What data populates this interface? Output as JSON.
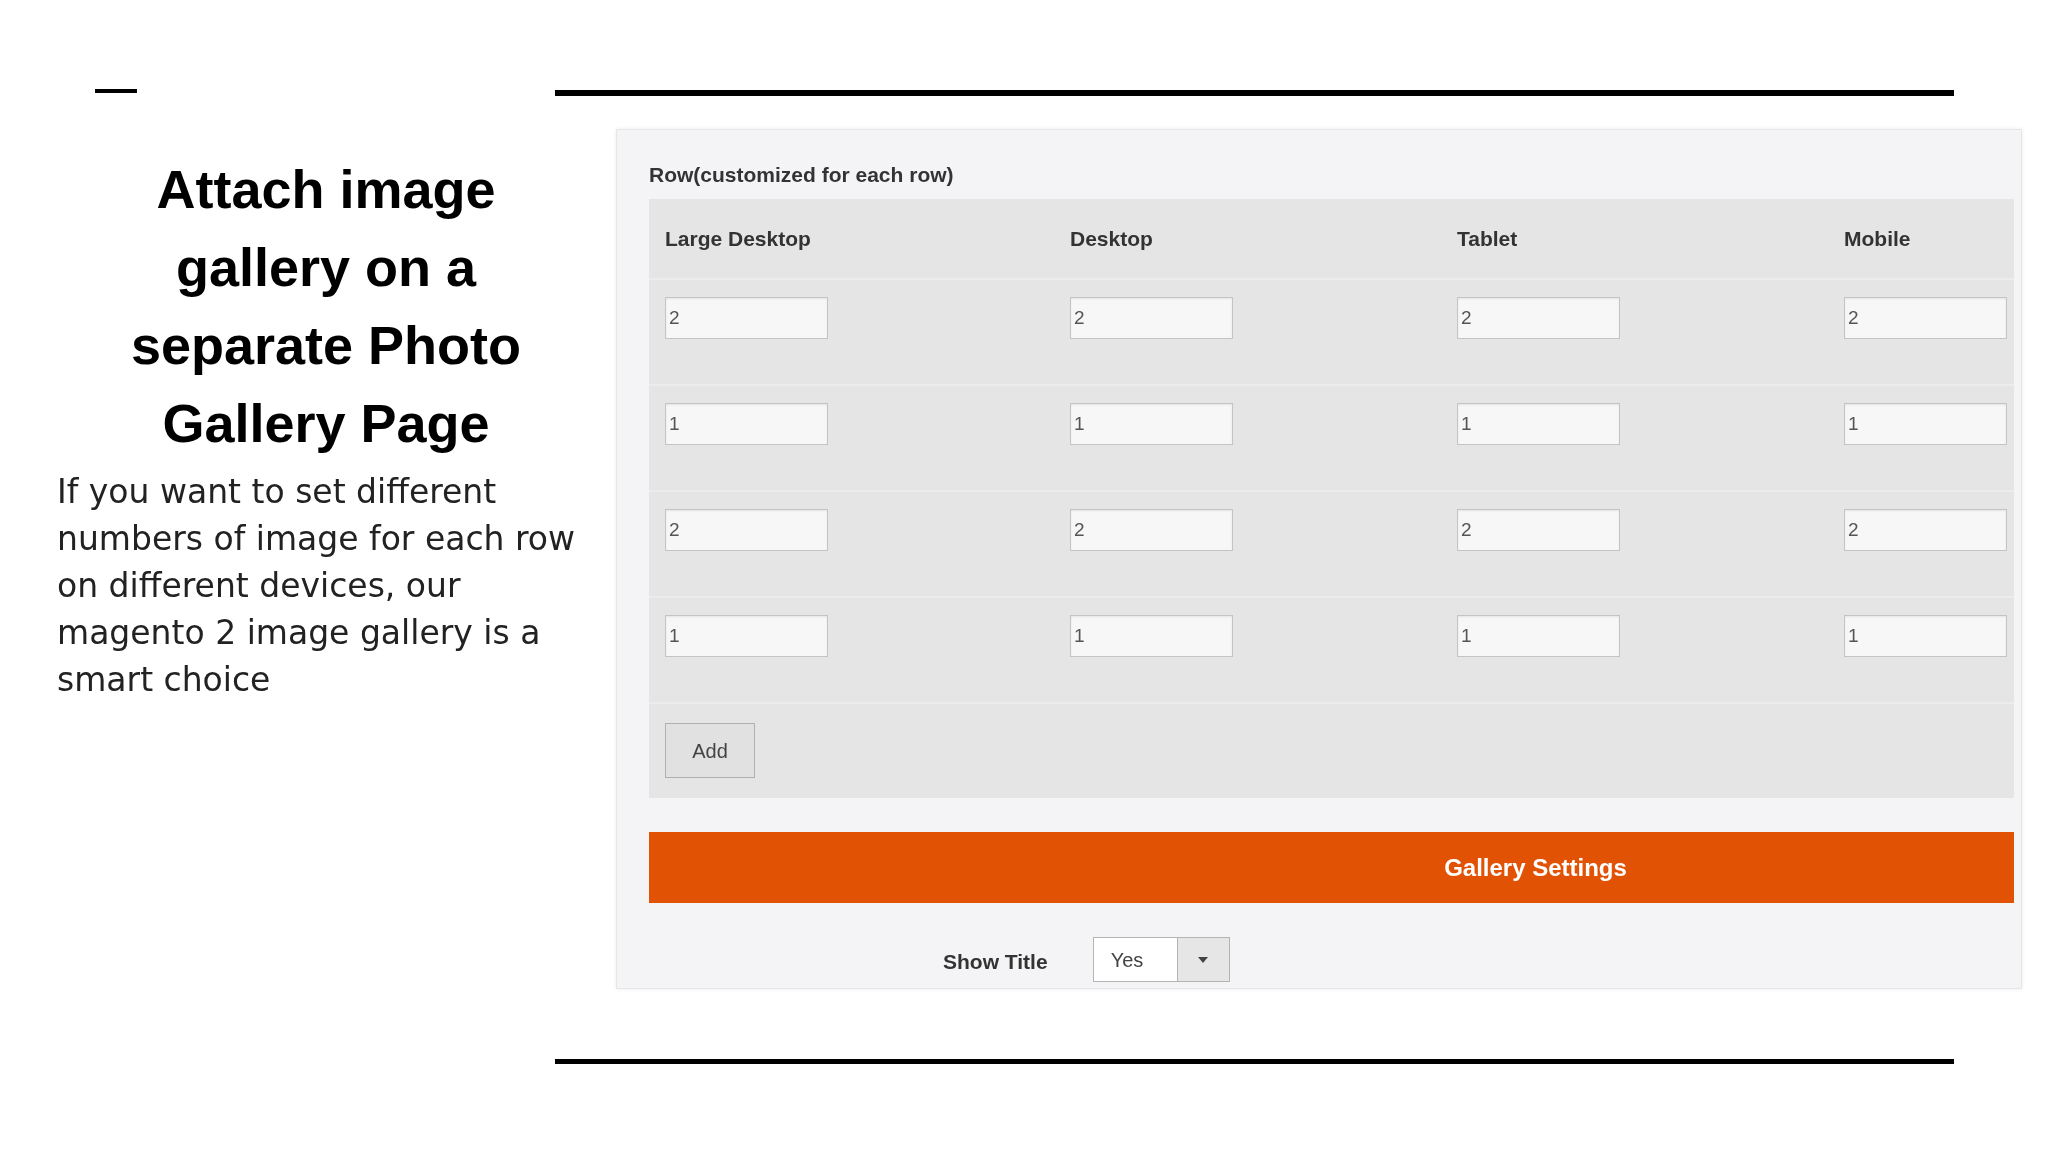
{
  "slide": {
    "title": "Attach image gallery on a separate Photo Gallery Page",
    "body": "If you want to set different numbers of image for each row on different devices, our magento 2 image gallery is a smart choice"
  },
  "screenshot": {
    "section_label": "Row(customized for each row)",
    "table": {
      "columns": [
        "Large Desktop",
        "Desktop",
        "Tablet",
        "Mobile"
      ],
      "rows": [
        [
          "2",
          "2",
          "2",
          "2"
        ],
        [
          "1",
          "1",
          "1",
          "1"
        ],
        [
          "2",
          "2",
          "2",
          "2"
        ],
        [
          "1",
          "1",
          "1",
          "1"
        ]
      ]
    },
    "add_button": "Add",
    "section_bar": "Gallery Settings",
    "show_title": {
      "label": "Show Title",
      "value": "Yes"
    }
  }
}
